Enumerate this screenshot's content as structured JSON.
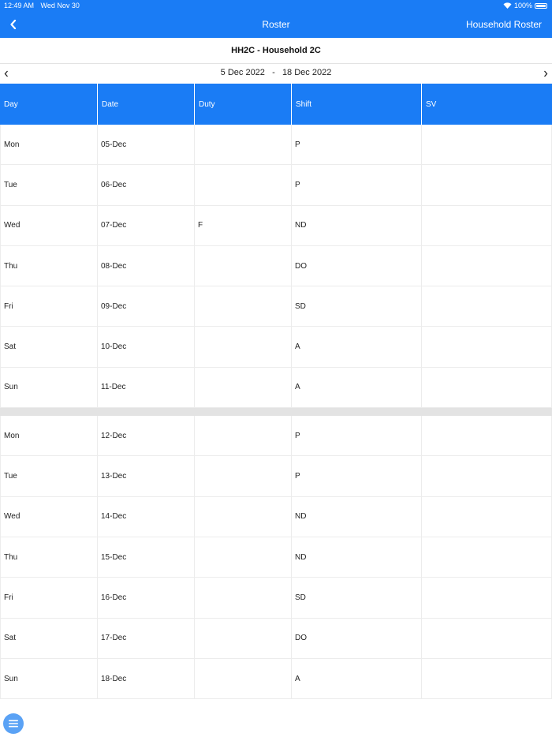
{
  "status": {
    "time": "12:49 AM",
    "date": "Wed Nov 30",
    "battery": "100%"
  },
  "nav": {
    "back_icon": "chevron-left-icon",
    "title": "Roster",
    "right_label": "Household Roster"
  },
  "household_title": "HH2C - Household 2C",
  "date_range": {
    "start": "5 Dec 2022",
    "separator": "-",
    "end": "18 Dec 2022",
    "prev_icon": "chevron-left-icon",
    "next_icon": "chevron-right-icon"
  },
  "table": {
    "headers": [
      "Day",
      "Date",
      "Duty",
      "Shift",
      "SV"
    ],
    "weeks": [
      [
        {
          "day": "Mon",
          "date": "05-Dec",
          "duty": "",
          "shift": "P",
          "sv": ""
        },
        {
          "day": "Tue",
          "date": "06-Dec",
          "duty": "",
          "shift": "P",
          "sv": ""
        },
        {
          "day": "Wed",
          "date": "07-Dec",
          "duty": "F",
          "shift": "ND",
          "sv": ""
        },
        {
          "day": "Thu",
          "date": "08-Dec",
          "duty": "",
          "shift": "DO",
          "sv": ""
        },
        {
          "day": "Fri",
          "date": "09-Dec",
          "duty": "",
          "shift": "SD",
          "sv": ""
        },
        {
          "day": "Sat",
          "date": "10-Dec",
          "duty": "",
          "shift": "A",
          "sv": ""
        },
        {
          "day": "Sun",
          "date": "11-Dec",
          "duty": "",
          "shift": "A",
          "sv": ""
        }
      ],
      [
        {
          "day": "Mon",
          "date": "12-Dec",
          "duty": "",
          "shift": "P",
          "sv": ""
        },
        {
          "day": "Tue",
          "date": "13-Dec",
          "duty": "",
          "shift": "P",
          "sv": ""
        },
        {
          "day": "Wed",
          "date": "14-Dec",
          "duty": "",
          "shift": "ND",
          "sv": ""
        },
        {
          "day": "Thu",
          "date": "15-Dec",
          "duty": "",
          "shift": "ND",
          "sv": ""
        },
        {
          "day": "Fri",
          "date": "16-Dec",
          "duty": "",
          "shift": "SD",
          "sv": ""
        },
        {
          "day": "Sat",
          "date": "17-Dec",
          "duty": "",
          "shift": "DO",
          "sv": ""
        },
        {
          "day": "Sun",
          "date": "18-Dec",
          "duty": "",
          "shift": "A",
          "sv": ""
        }
      ]
    ]
  },
  "fab_icon": "menu-icon",
  "colors": {
    "accent": "#1a7cf5",
    "fab": "#5aa2f5",
    "separator": "#e3e3e3"
  }
}
